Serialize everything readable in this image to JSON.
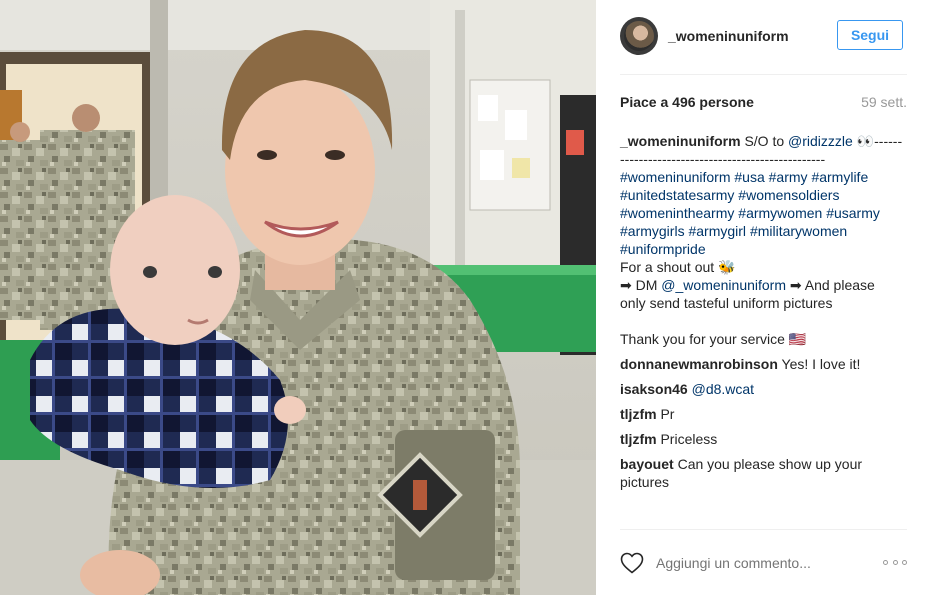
{
  "post": {
    "username": "_womeninuniform",
    "follow_label": "Segui",
    "likes": "Piace a 496 persone",
    "age": "59 sett.",
    "caption": {
      "username": "_womeninuniform",
      "text_intro": " S/O to ",
      "mention": "@ridizzzle",
      "eyes": " 👀------",
      "dashes": "--------------------------------------------",
      "tags": [
        [
          "#womeninuniform",
          "#usa",
          "#army",
          "#armylife"
        ],
        [
          "#unitedstatesarmy",
          "#womensoldiers"
        ],
        [
          "#womeninthearmy",
          "#armywomen",
          "#usarmy"
        ],
        [
          "#armygirls",
          "#armygirl",
          "#militarywomen"
        ],
        [
          "#uniformpride"
        ]
      ],
      "shoutout": "For a shout out 🐝",
      "dm_prefix": "➡ DM ",
      "dm_mention": "@_womeninuniform",
      "dm_suffix": " ➡ And please",
      "dm_line2": "only send tasteful uniform pictures",
      "thanks": "Thank you for your service 🇺🇸"
    },
    "comments": [
      {
        "user": "donnanewmanrobinson",
        "text": " Yes! I love it!"
      },
      {
        "user": "isakson46",
        "text": " ",
        "mention": "@d8.wcat"
      },
      {
        "user": "tljzfm",
        "text": " Pr"
      },
      {
        "user": "tljzfm",
        "text": " Priceless"
      },
      {
        "user": "bayouet",
        "text": " Can you please show up your pictures"
      }
    ],
    "add_comment_placeholder": "Aggiungi un commento...",
    "icons": {
      "like": "heart-outline-icon",
      "more": "more-options-icon"
    },
    "colors": {
      "link": "#003569",
      "follow_blue": "#3897f0",
      "muted": "#999999"
    }
  }
}
